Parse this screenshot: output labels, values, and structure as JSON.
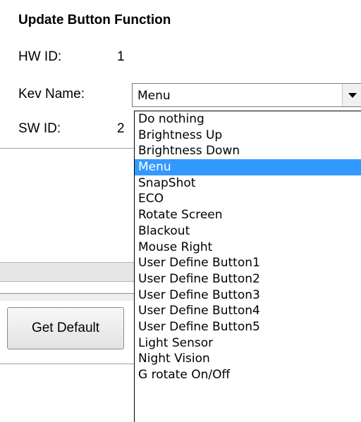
{
  "dialog": {
    "title": "Update Button Function",
    "hw_id_label": "HW ID:",
    "hw_id_value": "1",
    "key_name_label": "Kev Name:",
    "sw_id_label": "SW ID:",
    "sw_id_value": "2"
  },
  "key_name_select": {
    "selected": "Menu",
    "options": [
      "Do nothing",
      "Brightness Up",
      "Brightness Down",
      "Menu",
      "SnapShot",
      "ECO",
      "Rotate Screen",
      "Blackout",
      "Mouse Right",
      "User Define Button1",
      "User Define Button2",
      "User Define Button3",
      "User Define Button4",
      "User Define Button5",
      "Light Sensor",
      "Night Vision",
      "G rotate On/Off"
    ],
    "highlight_color": "#3399ff"
  },
  "buttons": {
    "get_default": "Get Default"
  }
}
